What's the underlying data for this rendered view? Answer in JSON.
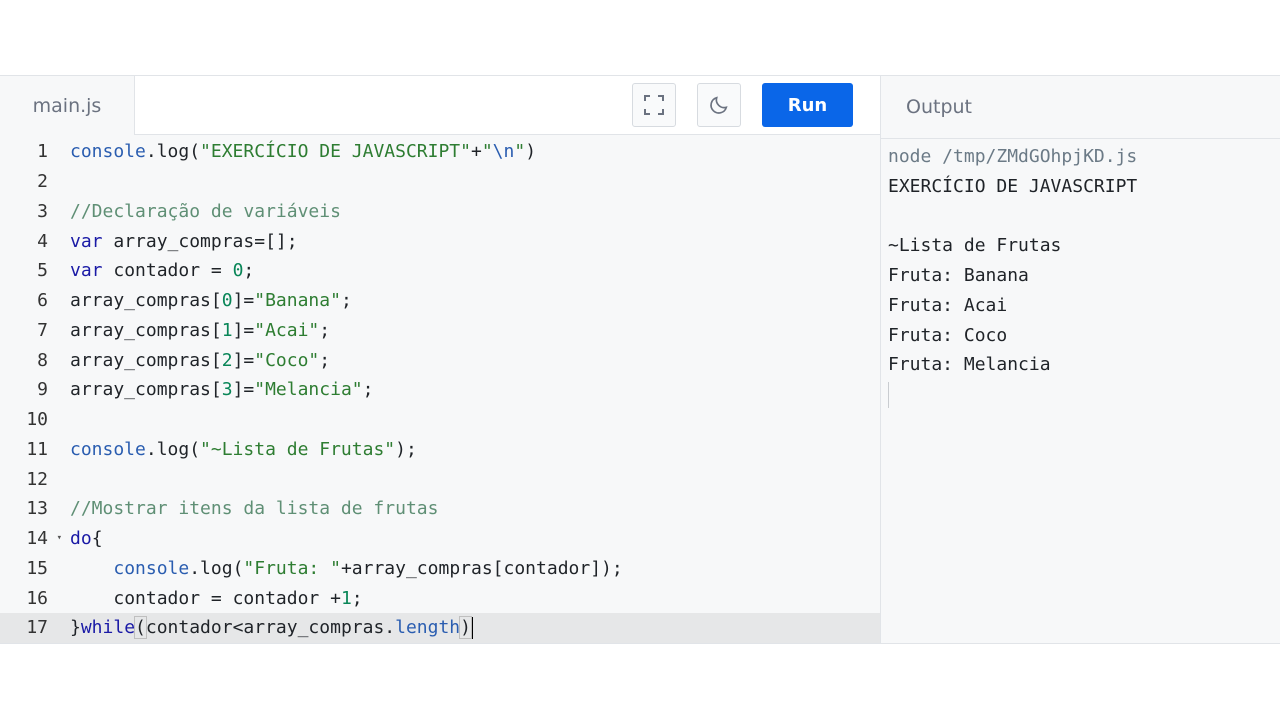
{
  "editor": {
    "tab_label": "main.js",
    "run_label": "Run",
    "fullscreen_icon": "fullscreen-icon",
    "theme_icon": "moon-icon"
  },
  "code": {
    "line_numbers": [
      "1",
      "2",
      "3",
      "4",
      "5",
      "6",
      "7",
      "8",
      "9",
      "10",
      "11",
      "12",
      "13",
      "14",
      "15",
      "16",
      "17"
    ],
    "l1": {
      "a": "console",
      "b": ".log(",
      "c": "\"EXERCÍCIO DE JAVASCRIPT\"",
      "d": "+",
      "e": "\"",
      "f": "\\n",
      "g": "\"",
      "h": ")"
    },
    "l3": "//Declaração de variáveis",
    "l4": {
      "a": "var",
      "b": " array_compras=[];"
    },
    "l5": {
      "a": "var",
      "b": " contador = ",
      "c": "0",
      "d": ";"
    },
    "l6": {
      "a": "array_compras[",
      "b": "0",
      "c": "]=",
      "d": "\"Banana\"",
      "e": ";"
    },
    "l7": {
      "a": "array_compras[",
      "b": "1",
      "c": "]=",
      "d": "\"Acai\"",
      "e": ";"
    },
    "l8": {
      "a": "array_compras[",
      "b": "2",
      "c": "]=",
      "d": "\"Coco\"",
      "e": ";"
    },
    "l9": {
      "a": "array_compras[",
      "b": "3",
      "c": "]=",
      "d": "\"Melancia\"",
      "e": ";"
    },
    "l11": {
      "a": "console",
      "b": ".log(",
      "c": "\"~Lista de Frutas\"",
      "d": ");"
    },
    "l13": "//Mostrar itens da lista de frutas",
    "l14": {
      "a": "do",
      "b": "{"
    },
    "l15": {
      "indent": "    ",
      "a": "console",
      "b": ".log(",
      "c": "\"Fruta: \"",
      "d": "+array_compras[contador]);"
    },
    "l16": {
      "indent": "    ",
      "a": "contador = contador +",
      "b": "1",
      "c": ";"
    },
    "l17": {
      "a": "}",
      "b": "while",
      "c": "(",
      "d": "contador<array_compras.",
      "e": "length",
      "f": ")"
    },
    "active_line": 17
  },
  "output": {
    "title": "Output",
    "lines": [
      "node /tmp/ZMdGOhpjKD.js",
      "EXERCÍCIO DE JAVASCRIPT",
      "",
      "~Lista de Frutas",
      "Fruta: Banana",
      "Fruta: Acai",
      "Fruta: Coco",
      "Fruta: Melancia"
    ]
  },
  "colors": {
    "run_button": "#0a66e8",
    "keyword": "#1a1aa6",
    "string": "#2e7d32",
    "comment": "#5f8f75",
    "active_line_bg": "#e6e7e8"
  }
}
